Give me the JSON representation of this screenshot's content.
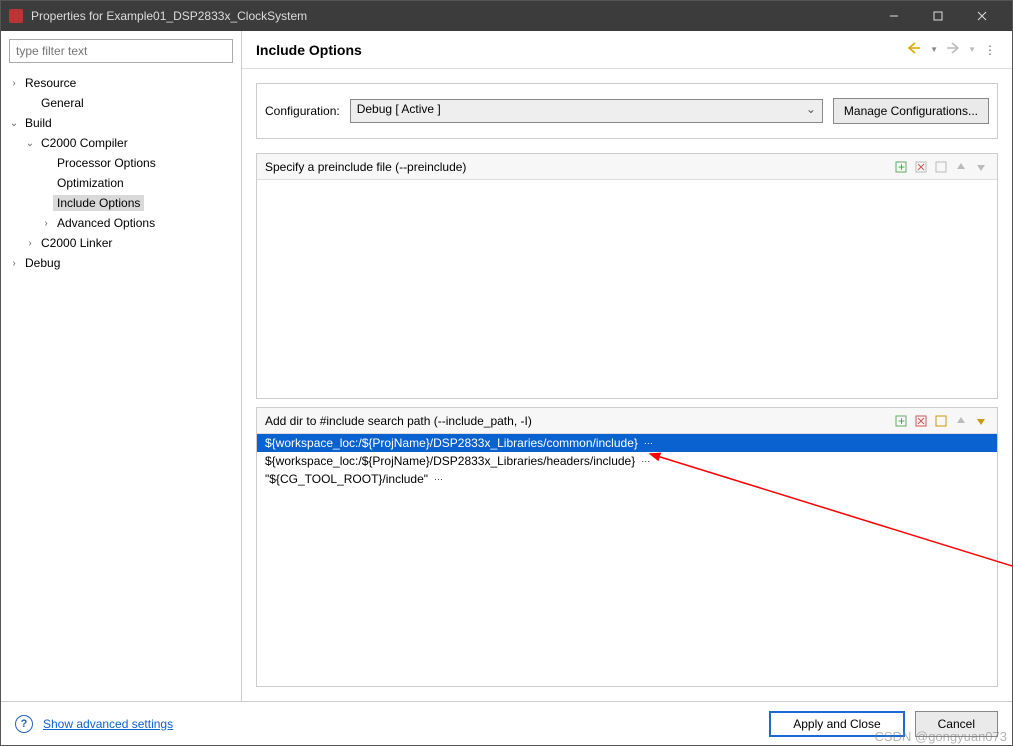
{
  "title": "Properties for Example01_DSP2833x_ClockSystem",
  "filter_placeholder": "type filter text",
  "tree": {
    "resource": "Resource",
    "general": "General",
    "build": "Build",
    "c2000_compiler": "C2000 Compiler",
    "processor_options": "Processor Options",
    "optimization": "Optimization",
    "include_options": "Include Options",
    "advanced_options": "Advanced Options",
    "c2000_linker": "C2000 Linker",
    "debug": "Debug"
  },
  "main": {
    "heading": "Include Options",
    "config_label": "Configuration:",
    "config_value": "Debug  [ Active ]",
    "manage_btn": "Manage Configurations..."
  },
  "preinclude": {
    "label": "Specify a preinclude file (--preinclude)"
  },
  "include_path": {
    "label": "Add dir to #include search path (--include_path, -I)",
    "items": [
      "${workspace_loc:/${ProjName}/DSP2833x_Libraries/common/include}",
      "${workspace_loc:/${ProjName}/DSP2833x_Libraries/headers/include}",
      "\"${CG_TOOL_ROOT}/include\""
    ]
  },
  "footer": {
    "advanced_link": "Show advanced settings",
    "apply_close": "Apply and Close",
    "cancel": "Cancel"
  },
  "watermark": "CSDN @gongyuan073"
}
